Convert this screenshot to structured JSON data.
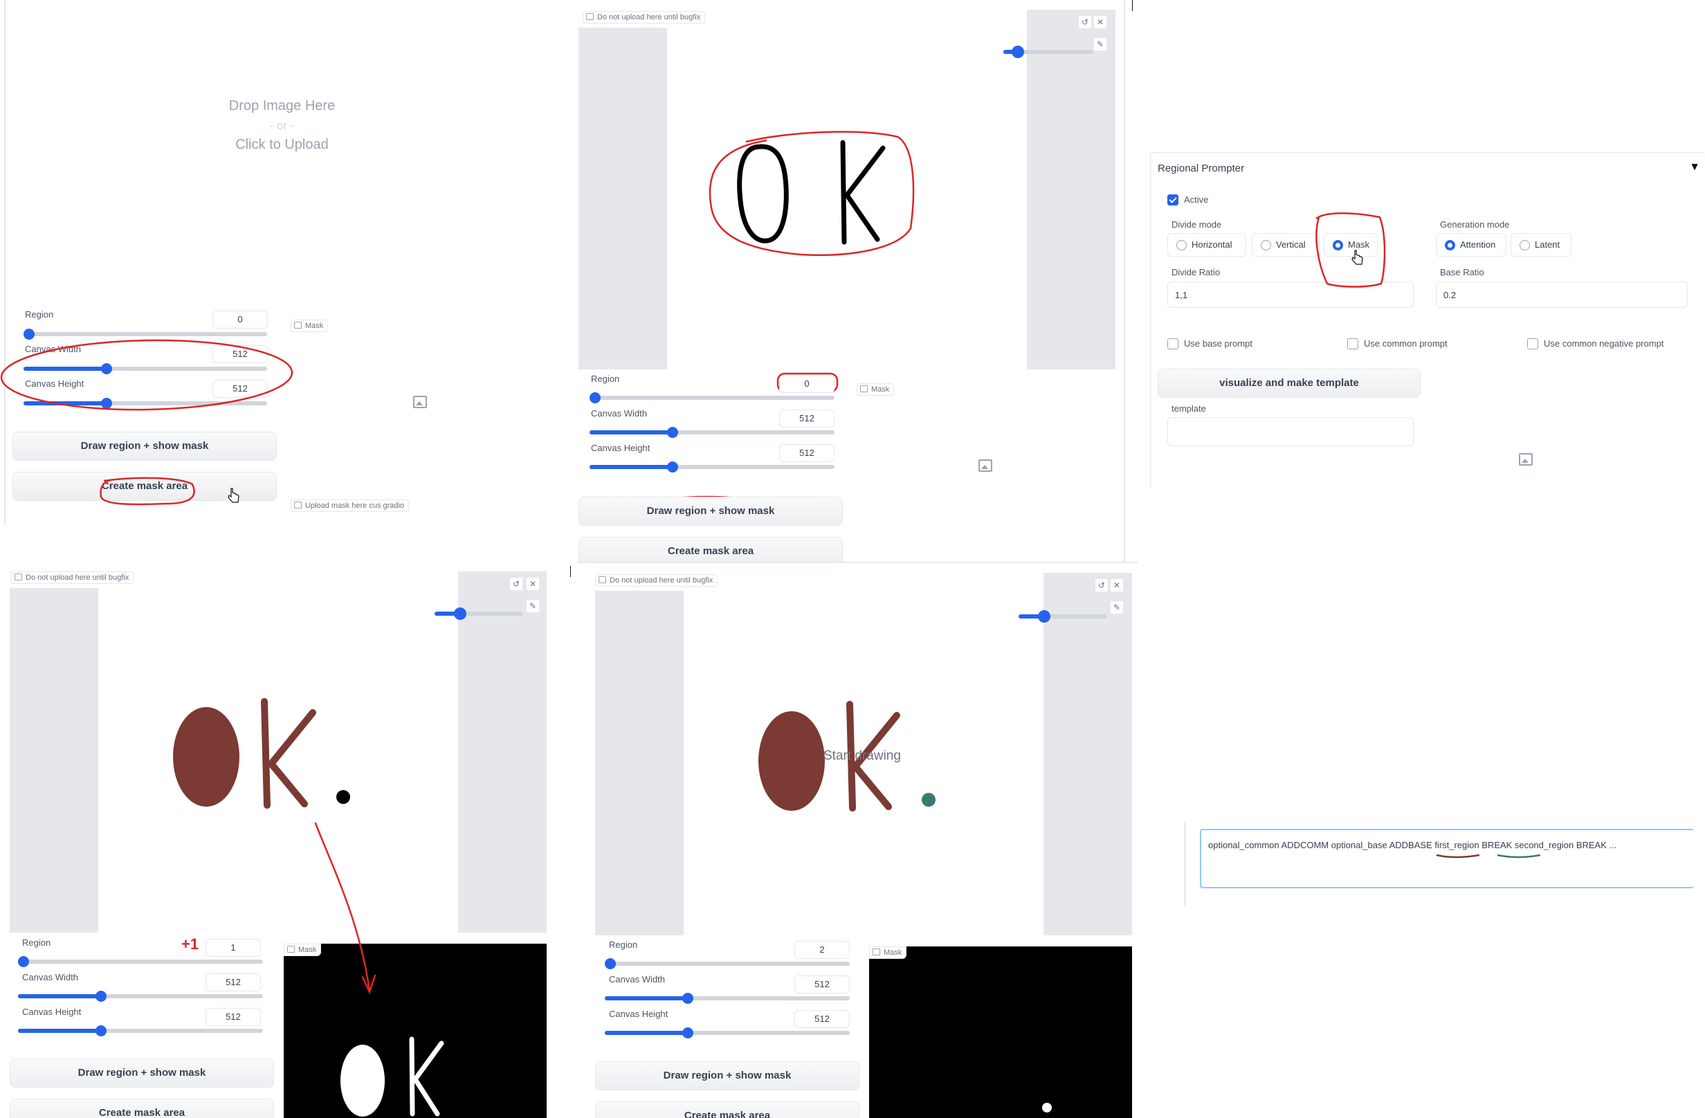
{
  "panel1": {
    "drop_title": "Drop Image Here",
    "drop_or": "- or -",
    "drop_click": "Click to Upload",
    "region_label": "Region",
    "region_value": "0",
    "width_label": "Canvas Width",
    "width_value": "512",
    "height_label": "Canvas Height",
    "height_value": "512",
    "mask_tag": "Mask",
    "draw_button": "Draw region + show mask",
    "create_button": "Create mask area",
    "upload_mask_tag": "Upload mask here cus gradio",
    "sliders": {
      "region": 0.0,
      "width": 0.34,
      "height": 0.34
    }
  },
  "panel2": {
    "tag": "Do not upload here until bugfix",
    "drawing_text": "OK",
    "region_label": "Region",
    "region_value": "0",
    "width_label": "Canvas Width",
    "width_value": "512",
    "height_label": "Canvas Height",
    "height_value": "512",
    "mask_tag": "Mask",
    "draw_button": "Draw region + show mask",
    "create_button": "Create mask area"
  },
  "panel3": {
    "title": "Regional Prompter",
    "collapse_glyph": "▼",
    "active_label": "Active",
    "divide_mode_label": "Divide mode",
    "divide_options": [
      "Horizontal",
      "Vertical",
      "Mask"
    ],
    "divide_selected": "Mask",
    "generation_mode_label": "Generation mode",
    "generation_options": [
      "Attention",
      "Latent"
    ],
    "generation_selected": "Attention",
    "divide_ratio_label": "Divide Ratio",
    "divide_ratio_value": "1,1",
    "base_ratio_label": "Base Ratio",
    "base_ratio_value": "0.2",
    "use_base_prompt": "Use base prompt",
    "use_common_prompt": "Use common prompt",
    "use_common_negative_prompt": "Use common negative prompt",
    "visualize_button": "visualize and make template",
    "template_label": "template"
  },
  "panel4": {
    "tag": "Do not upload here until bugfix",
    "region_label": "Region",
    "region_value": "1",
    "plus_annotation": "+1",
    "width_label": "Canvas Width",
    "width_value": "512",
    "height_label": "Canvas Height",
    "height_value": "512",
    "mask_tag": "Mask",
    "draw_button": "Draw region + show mask",
    "create_button": "Create mask area",
    "stroke_color": "#7b3a34",
    "dot_color": "#000000"
  },
  "panel5": {
    "tag": "Do not upload here until bugfix",
    "overlay_text": "Start drawing",
    "region_label": "Region",
    "region_value": "2",
    "width_label": "Canvas Width",
    "width_value": "512",
    "height_label": "Canvas Height",
    "height_value": "512",
    "mask_tag": "Mask",
    "draw_button": "Draw region + show mask",
    "create_button": "Create mask area",
    "stroke_color": "#7b3a34",
    "dot_color": "#3a7a73"
  },
  "panel6": {
    "prompt_text": "optional_common ADDCOMM optional_base ADDBASE first_region BREAK second_region BREAK ..."
  }
}
